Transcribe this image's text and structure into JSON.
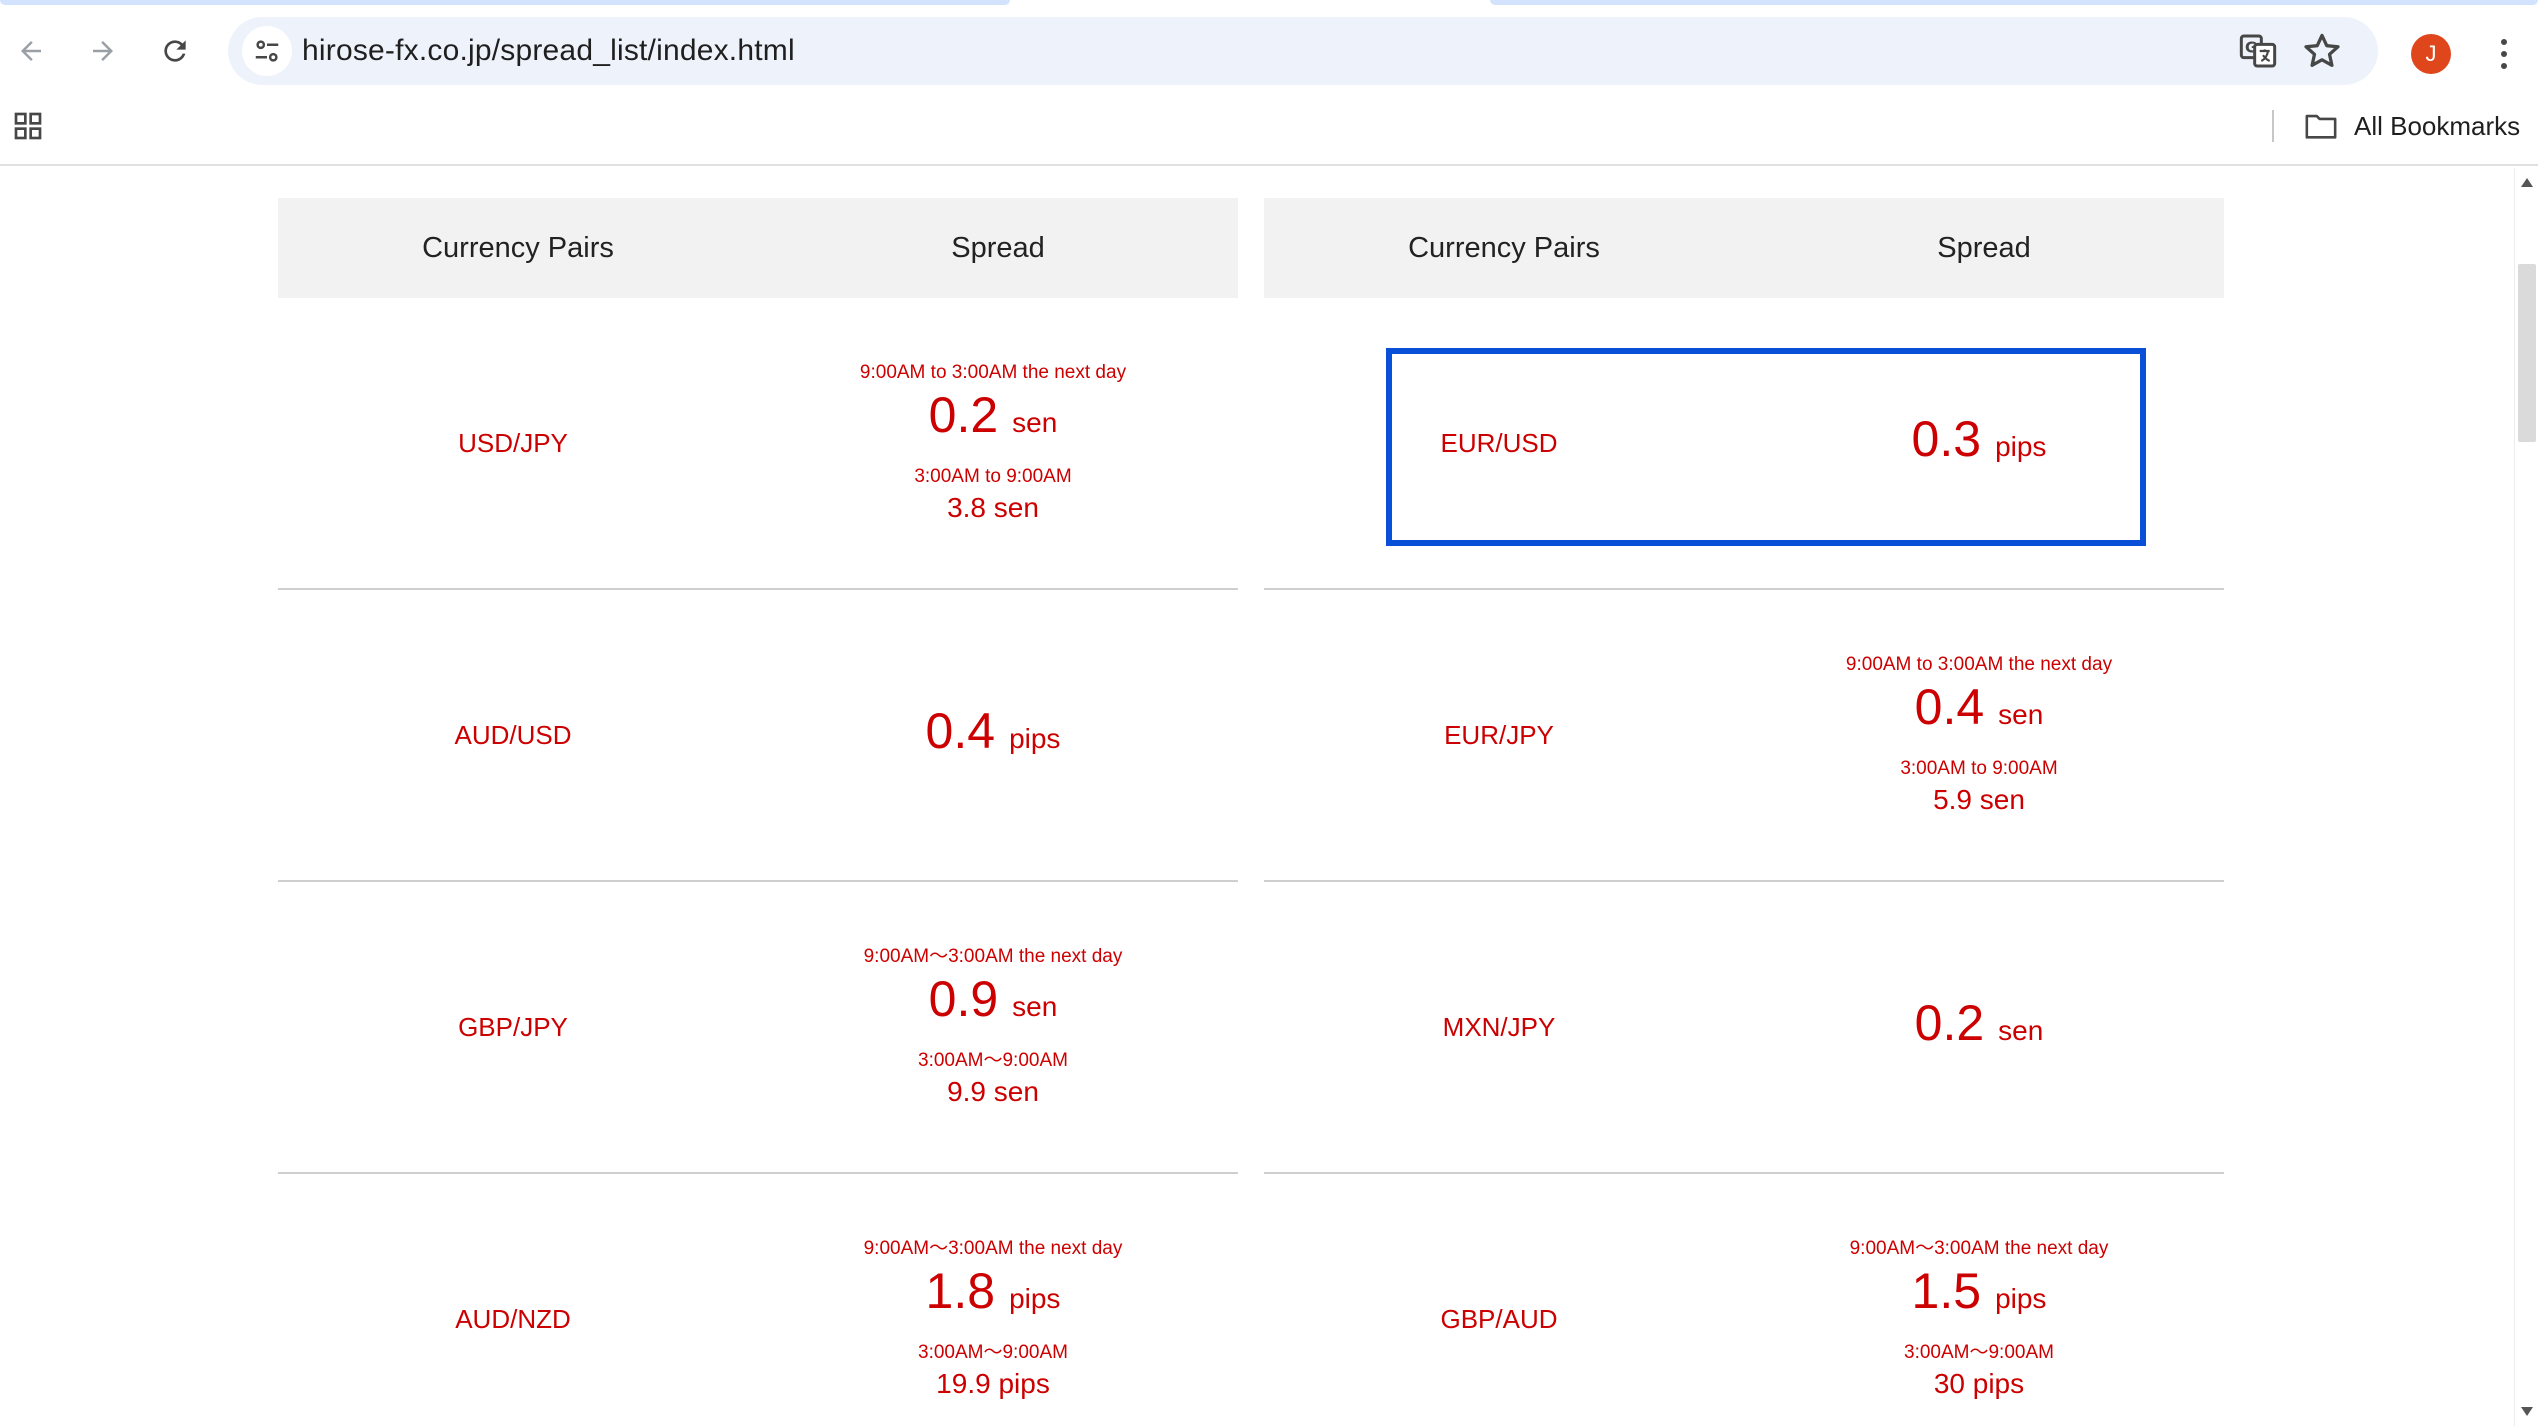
{
  "browser": {
    "url": "hirose-fx.co.jp/spread_list/index.html",
    "avatar_letter": "J",
    "bookmarks_label": "All Bookmarks",
    "accent_color": "#0a4fd8",
    "avatar_color": "#e0461c"
  },
  "tables": {
    "left": {
      "header_pair": "Currency Pairs",
      "header_spread": "Spread",
      "rows": [
        {
          "pair": "USD/JPY",
          "time1": "9:00AM to 3:00AM the next day",
          "value1": "0.2",
          "unit1": "sen",
          "time2": "3:00AM to 9:00AM",
          "value2": "3.8 sen"
        },
        {
          "pair": "AUD/USD",
          "value1": "0.4",
          "unit1": "pips"
        },
        {
          "pair": "GBP/JPY",
          "time1": "9:00AM〜3:00AM the next day",
          "value1": "0.9",
          "unit1": "sen",
          "time2": "3:00AM〜9:00AM",
          "value2": "9.9 sen"
        },
        {
          "pair": "AUD/NZD",
          "time1": "9:00AM〜3:00AM the next day",
          "value1": "1.8",
          "unit1": "pips",
          "time2": "3:00AM〜9:00AM",
          "value2": "19.9 pips"
        }
      ]
    },
    "right": {
      "header_pair": "Currency Pairs",
      "header_spread": "Spread",
      "rows": [
        {
          "pair": "EUR/USD",
          "value1": "0.3",
          "unit1": "pips",
          "highlighted": true
        },
        {
          "pair": "EUR/JPY",
          "time1": "9:00AM to 3:00AM the next day",
          "value1": "0.4",
          "unit1": "sen",
          "time2": "3:00AM to 9:00AM",
          "value2": "5.9 sen"
        },
        {
          "pair": "MXN/JPY",
          "value1": "0.2",
          "unit1": "sen"
        },
        {
          "pair": "GBP/AUD",
          "time1": "9:00AM〜3:00AM the next day",
          "value1": "1.5",
          "unit1": "pips",
          "time2": "3:00AM〜9:00AM",
          "value2": "30 pips"
        }
      ]
    }
  },
  "colors": {
    "text_red": "#cc0000",
    "header_bg": "#f2f2f2"
  }
}
